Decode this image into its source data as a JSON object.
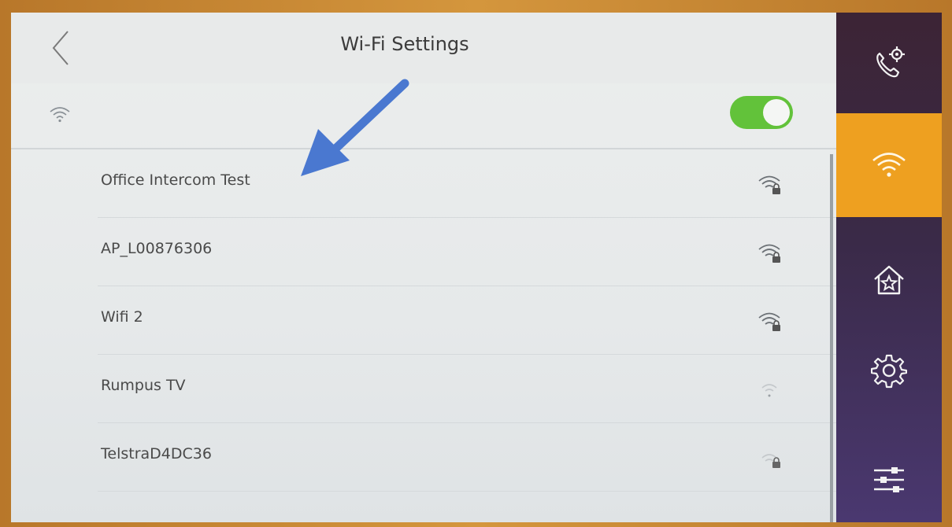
{
  "header": {
    "title": "Wi-Fi Settings"
  },
  "wifi": {
    "enabled": true
  },
  "networks": [
    {
      "name": "Office Intercom Test",
      "signal_icon": "wifi-lock-icon",
      "secured": true
    },
    {
      "name": "AP_L00876306",
      "signal_icon": "wifi-lock-icon",
      "secured": true
    },
    {
      "name": "Wifi 2",
      "signal_icon": "wifi-lock-icon",
      "secured": true
    },
    {
      "name": "Rumpus TV",
      "signal_icon": "wifi-weak-icon",
      "secured": false
    },
    {
      "name": "TelstraD4DC36",
      "signal_icon": "wifi-lock-icon",
      "secured": true
    }
  ],
  "sidebar": {
    "items": [
      {
        "icon": "phone-settings-icon",
        "active": false
      },
      {
        "icon": "wifi-icon",
        "active": true
      },
      {
        "icon": "home-star-icon",
        "active": false
      },
      {
        "icon": "gear-icon",
        "active": false
      },
      {
        "icon": "sliders-icon",
        "active": false
      }
    ]
  },
  "colors": {
    "accent_active": "#eea020",
    "toggle_on": "#62c23a",
    "sidebar_bg": "#3c2435",
    "annotation_arrow": "#4a78d0"
  }
}
